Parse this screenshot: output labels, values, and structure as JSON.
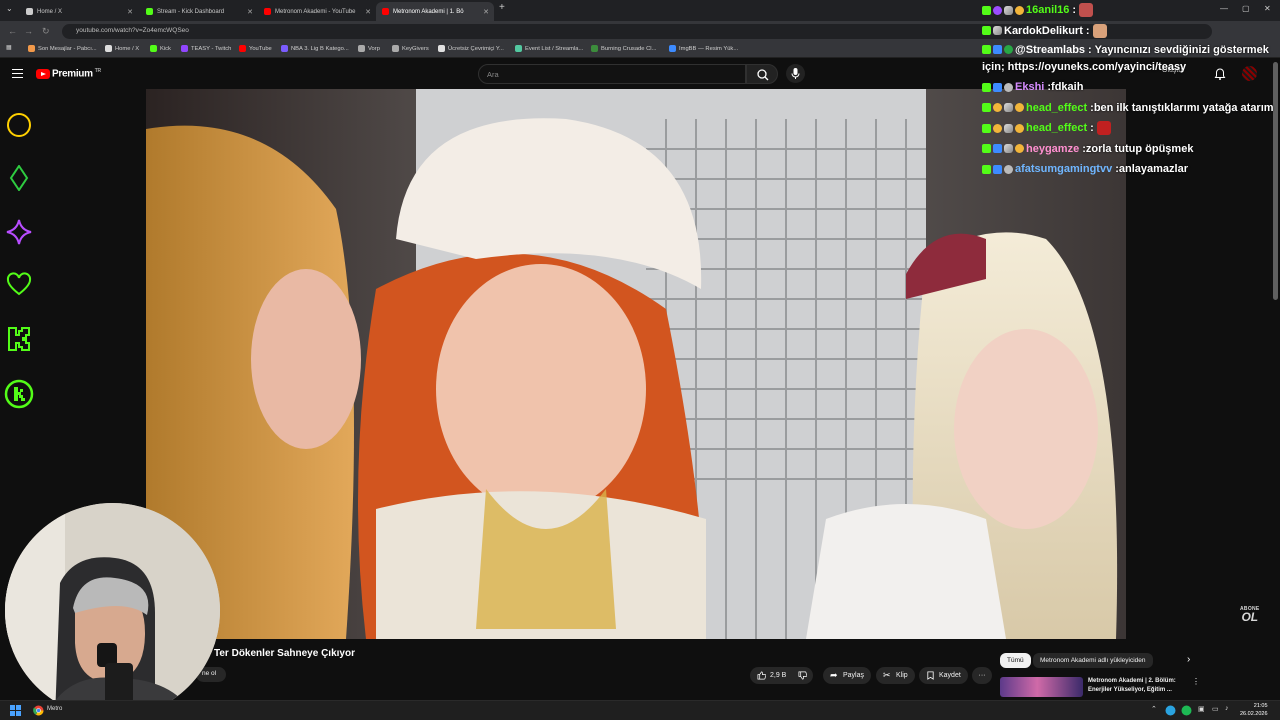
{
  "browser": {
    "tabs": [
      {
        "title": "Home / X",
        "fav": "#cccccc",
        "active": false
      },
      {
        "title": "Stream - Kick Dashboard",
        "fav": "#53fc18",
        "active": false
      },
      {
        "title": "Metronom Akademi - YouTube",
        "fav": "#ff0000",
        "active": false
      },
      {
        "title": "Metronom Akademi | 1. Bö",
        "fav": "#ff0000",
        "active": true
      }
    ],
    "new_tab": "+",
    "url": "youtube.com/watch?v=Zo4emcWQSeo",
    "bookmarks": [
      {
        "label": "Son Mesajlar - Pabcı...",
        "color": "#f2994a"
      },
      {
        "label": "Home / X",
        "color": "#dddddd"
      },
      {
        "label": "Kick",
        "color": "#53fc18"
      },
      {
        "label": "TEASY - Twitch",
        "color": "#9146ff"
      },
      {
        "label": "YouTube",
        "color": "#ff0000"
      },
      {
        "label": "NBA 3. Lig B Katego...",
        "color": "#7b5cff"
      },
      {
        "label": "Vorp",
        "color": "#aaaaaa"
      },
      {
        "label": "KeyGivers",
        "color": "#aaaaaa"
      },
      {
        "label": "Ücretsiz Çevrimiçi Y...",
        "color": "#e0e0e0"
      },
      {
        "label": "Event List / Streamla...",
        "color": "#53c8a0"
      },
      {
        "label": "Burning Crusade Cl...",
        "color": "#3c8c3c"
      },
      {
        "label": "ImgBB — Resim Yük...",
        "color": "#3d8bff"
      }
    ]
  },
  "youtube": {
    "brand": "Premium",
    "brand_region": "TR",
    "search_placeholder": "Ara",
    "create_label": "Oluştur",
    "video_title": "Ter Dökenler Sahneye Çıkıyor",
    "subscribe_partial": "ne ol",
    "actions": {
      "likes": "2,9 B",
      "share": "Paylaş",
      "clip": "Klip",
      "save": "Kaydet",
      "more": "···"
    },
    "chips": {
      "all": "Tümü",
      "channel": "Metronom Akademi adlı yükleyiciden",
      "next": "›"
    },
    "recommended": {
      "title": "Metronom Akademi | 2. Bölüm: Enerjiler Yükseliyor, Eğitim ...",
      "more": "⋮"
    },
    "watermark": {
      "small": "ABONE",
      "big": "OL"
    }
  },
  "overlay_shapes": [
    {
      "name": "circle-shape-icon",
      "color": "#ffd000"
    },
    {
      "name": "diamond-shape-icon",
      "color": "#2ecc40"
    },
    {
      "name": "star-shape-icon",
      "color": "#b84dff"
    },
    {
      "name": "heart-shape-icon",
      "color": "#53fc18"
    },
    {
      "name": "kick-logo-icon",
      "color": "#53fc18"
    },
    {
      "name": "kick-round-logo-icon",
      "color": "#53fc18"
    }
  ],
  "chat": [
    {
      "user": "16anil16",
      "message": "",
      "color": "#53fc18",
      "badges": [
        "b-k",
        "b-purple",
        "b-rocket",
        "b-gold"
      ],
      "emote": "#c0504d"
    },
    {
      "user": "KardokDelikurt",
      "message": "",
      "color": "#ffffff",
      "badges": [
        "b-k",
        "b-rocket"
      ],
      "emote": "#d9a17a"
    },
    {
      "user": "@Streamlabs",
      "message": "Yayıncınızı sevdiğinizi göstermek için; https://oyuneks.com/yayinci/teasy",
      "color": "#ffffff",
      "badges": [
        "b-k",
        "b-blue",
        "b-green"
      ],
      "emote": ""
    },
    {
      "user": "Ekshi",
      "message": "fdkaih",
      "color": "#d68cff",
      "badges": [
        "b-k",
        "b-blue",
        "b-gray"
      ],
      "emote": ""
    },
    {
      "user": "head_effect",
      "message": "ben ilk tanıştıklarımı yatağa atarım",
      "color": "#53fc18",
      "badges": [
        "b-k",
        "b-gold",
        "b-rocket",
        "b-gold"
      ],
      "emote": ""
    },
    {
      "user": "head_effect",
      "message": "",
      "color": "#53fc18",
      "badges": [
        "b-k",
        "b-gold",
        "b-rocket",
        "b-gold"
      ],
      "emote": "#c02020"
    },
    {
      "user": "heygamze",
      "message": "zorla tutup öpüşmek",
      "color": "#ff8fd0",
      "badges": [
        "b-k",
        "b-blue",
        "b-rocket",
        "b-gold"
      ],
      "emote": ""
    },
    {
      "user": "afatsumgamingtvv",
      "message": "anlayamazlar",
      "color": "#6fb6ff",
      "badges": [
        "b-k",
        "b-blue",
        "b-gray"
      ],
      "emote": ""
    }
  ],
  "taskbar": {
    "chrome_label": "Metro",
    "time": "21:05",
    "date": "26.02.2026"
  }
}
